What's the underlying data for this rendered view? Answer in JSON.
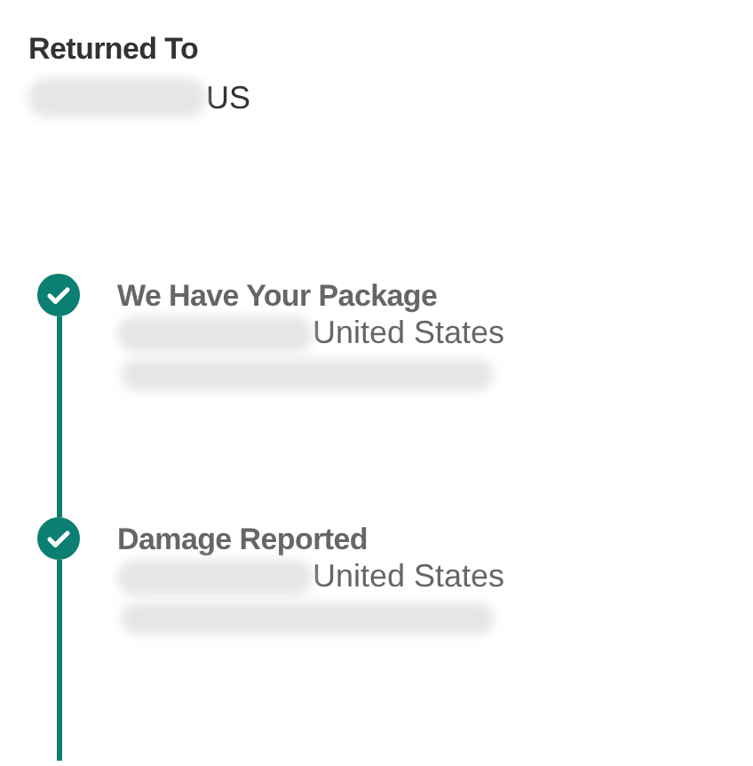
{
  "returned_to": {
    "label": "Returned To",
    "country": "US"
  },
  "events": [
    {
      "title": "We Have Your Package",
      "location": "United States",
      "completed": true
    },
    {
      "title": "Damage Reported",
      "location": "United States",
      "completed": true
    }
  ]
}
